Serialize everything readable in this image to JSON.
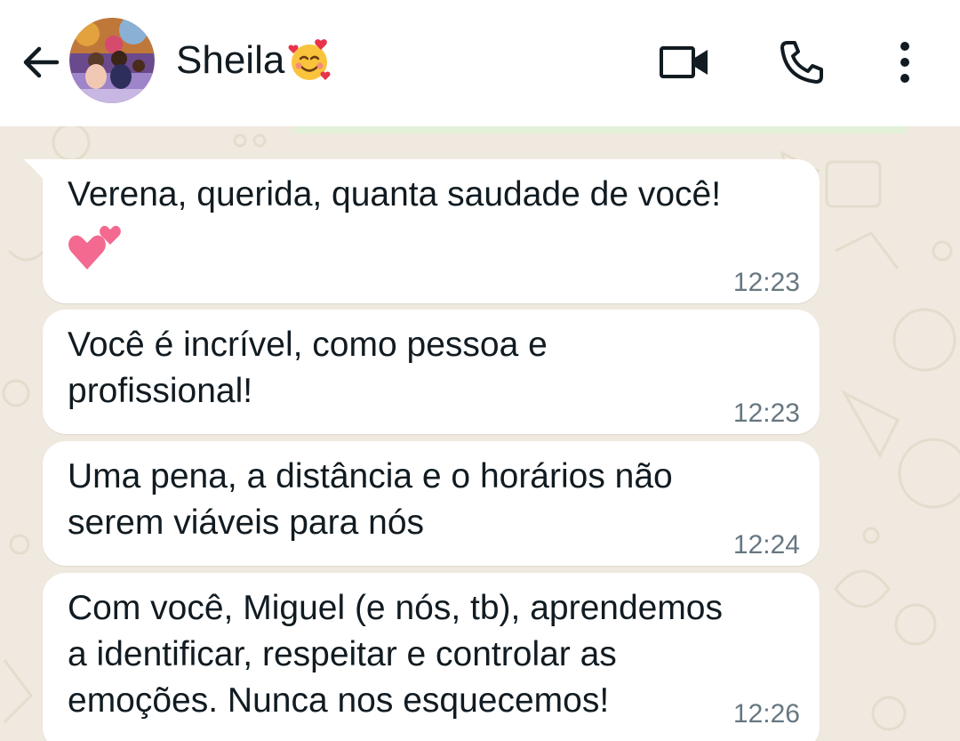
{
  "header": {
    "contact_name": "Sheila",
    "name_emoji": "smiling-face-with-hearts",
    "icons": {
      "back": "back-arrow-icon",
      "video": "video-call-icon",
      "voice": "phone-call-icon",
      "menu": "more-options-icon"
    }
  },
  "messages": [
    {
      "text": "Verena, querida, quanta saudade de você!",
      "emoji": "two-hearts",
      "time": "12:23"
    },
    {
      "text": "Você é incrível, como pessoa e\nprofissional!",
      "time": "12:23"
    },
    {
      "text": "Uma pena, a distância e o horários não\nserem viáveis para nós",
      "time": "12:24"
    },
    {
      "text": "Com você, Miguel (e nós, tb), aprendemos\na identificar, respeitar e controlar as\nemoções. Nunca nos esquecemos!",
      "time": "12:26"
    }
  ],
  "colors": {
    "header_bg": "#ffffff",
    "chat_bg": "#efe9df",
    "bubble_bg": "#ffffff",
    "text": "#111b21",
    "time": "#667781"
  }
}
